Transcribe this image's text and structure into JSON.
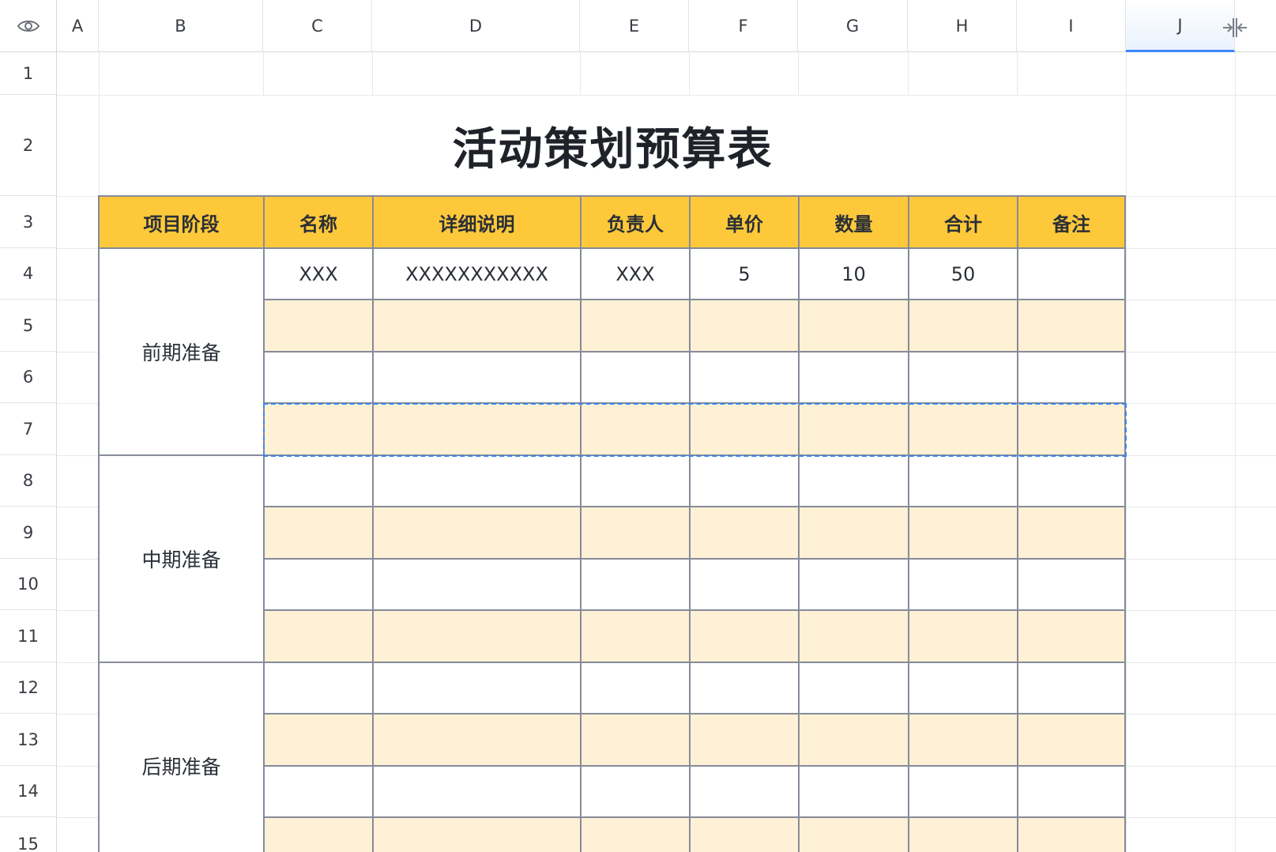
{
  "columns": [
    "A",
    "B",
    "C",
    "D",
    "E",
    "F",
    "G",
    "H",
    "I",
    "J"
  ],
  "rows": [
    "1",
    "2",
    "3",
    "4",
    "5",
    "6",
    "7",
    "8",
    "9",
    "10",
    "11",
    "12",
    "13",
    "14",
    "15"
  ],
  "selected_column": "J",
  "corner_icon": "eye-icon",
  "collapse_icon": "collapse-columns-icon",
  "title": "活动策划预算表",
  "headers": [
    "项目阶段",
    "名称",
    "详细说明",
    "负责人",
    "单价",
    "数量",
    "合计",
    "备注"
  ],
  "example_row": {
    "name": "XXX",
    "detail": "XXXXXXXXXXX",
    "owner": "XXX",
    "price": "5",
    "qty": "10",
    "total": "50",
    "note": ""
  },
  "phases": [
    "前期准备",
    "中期准备",
    "后期准备"
  ],
  "colors": {
    "header_fill": "#fdc93b",
    "band_fill": "#fef1d6",
    "selection": "#3b86f7"
  }
}
